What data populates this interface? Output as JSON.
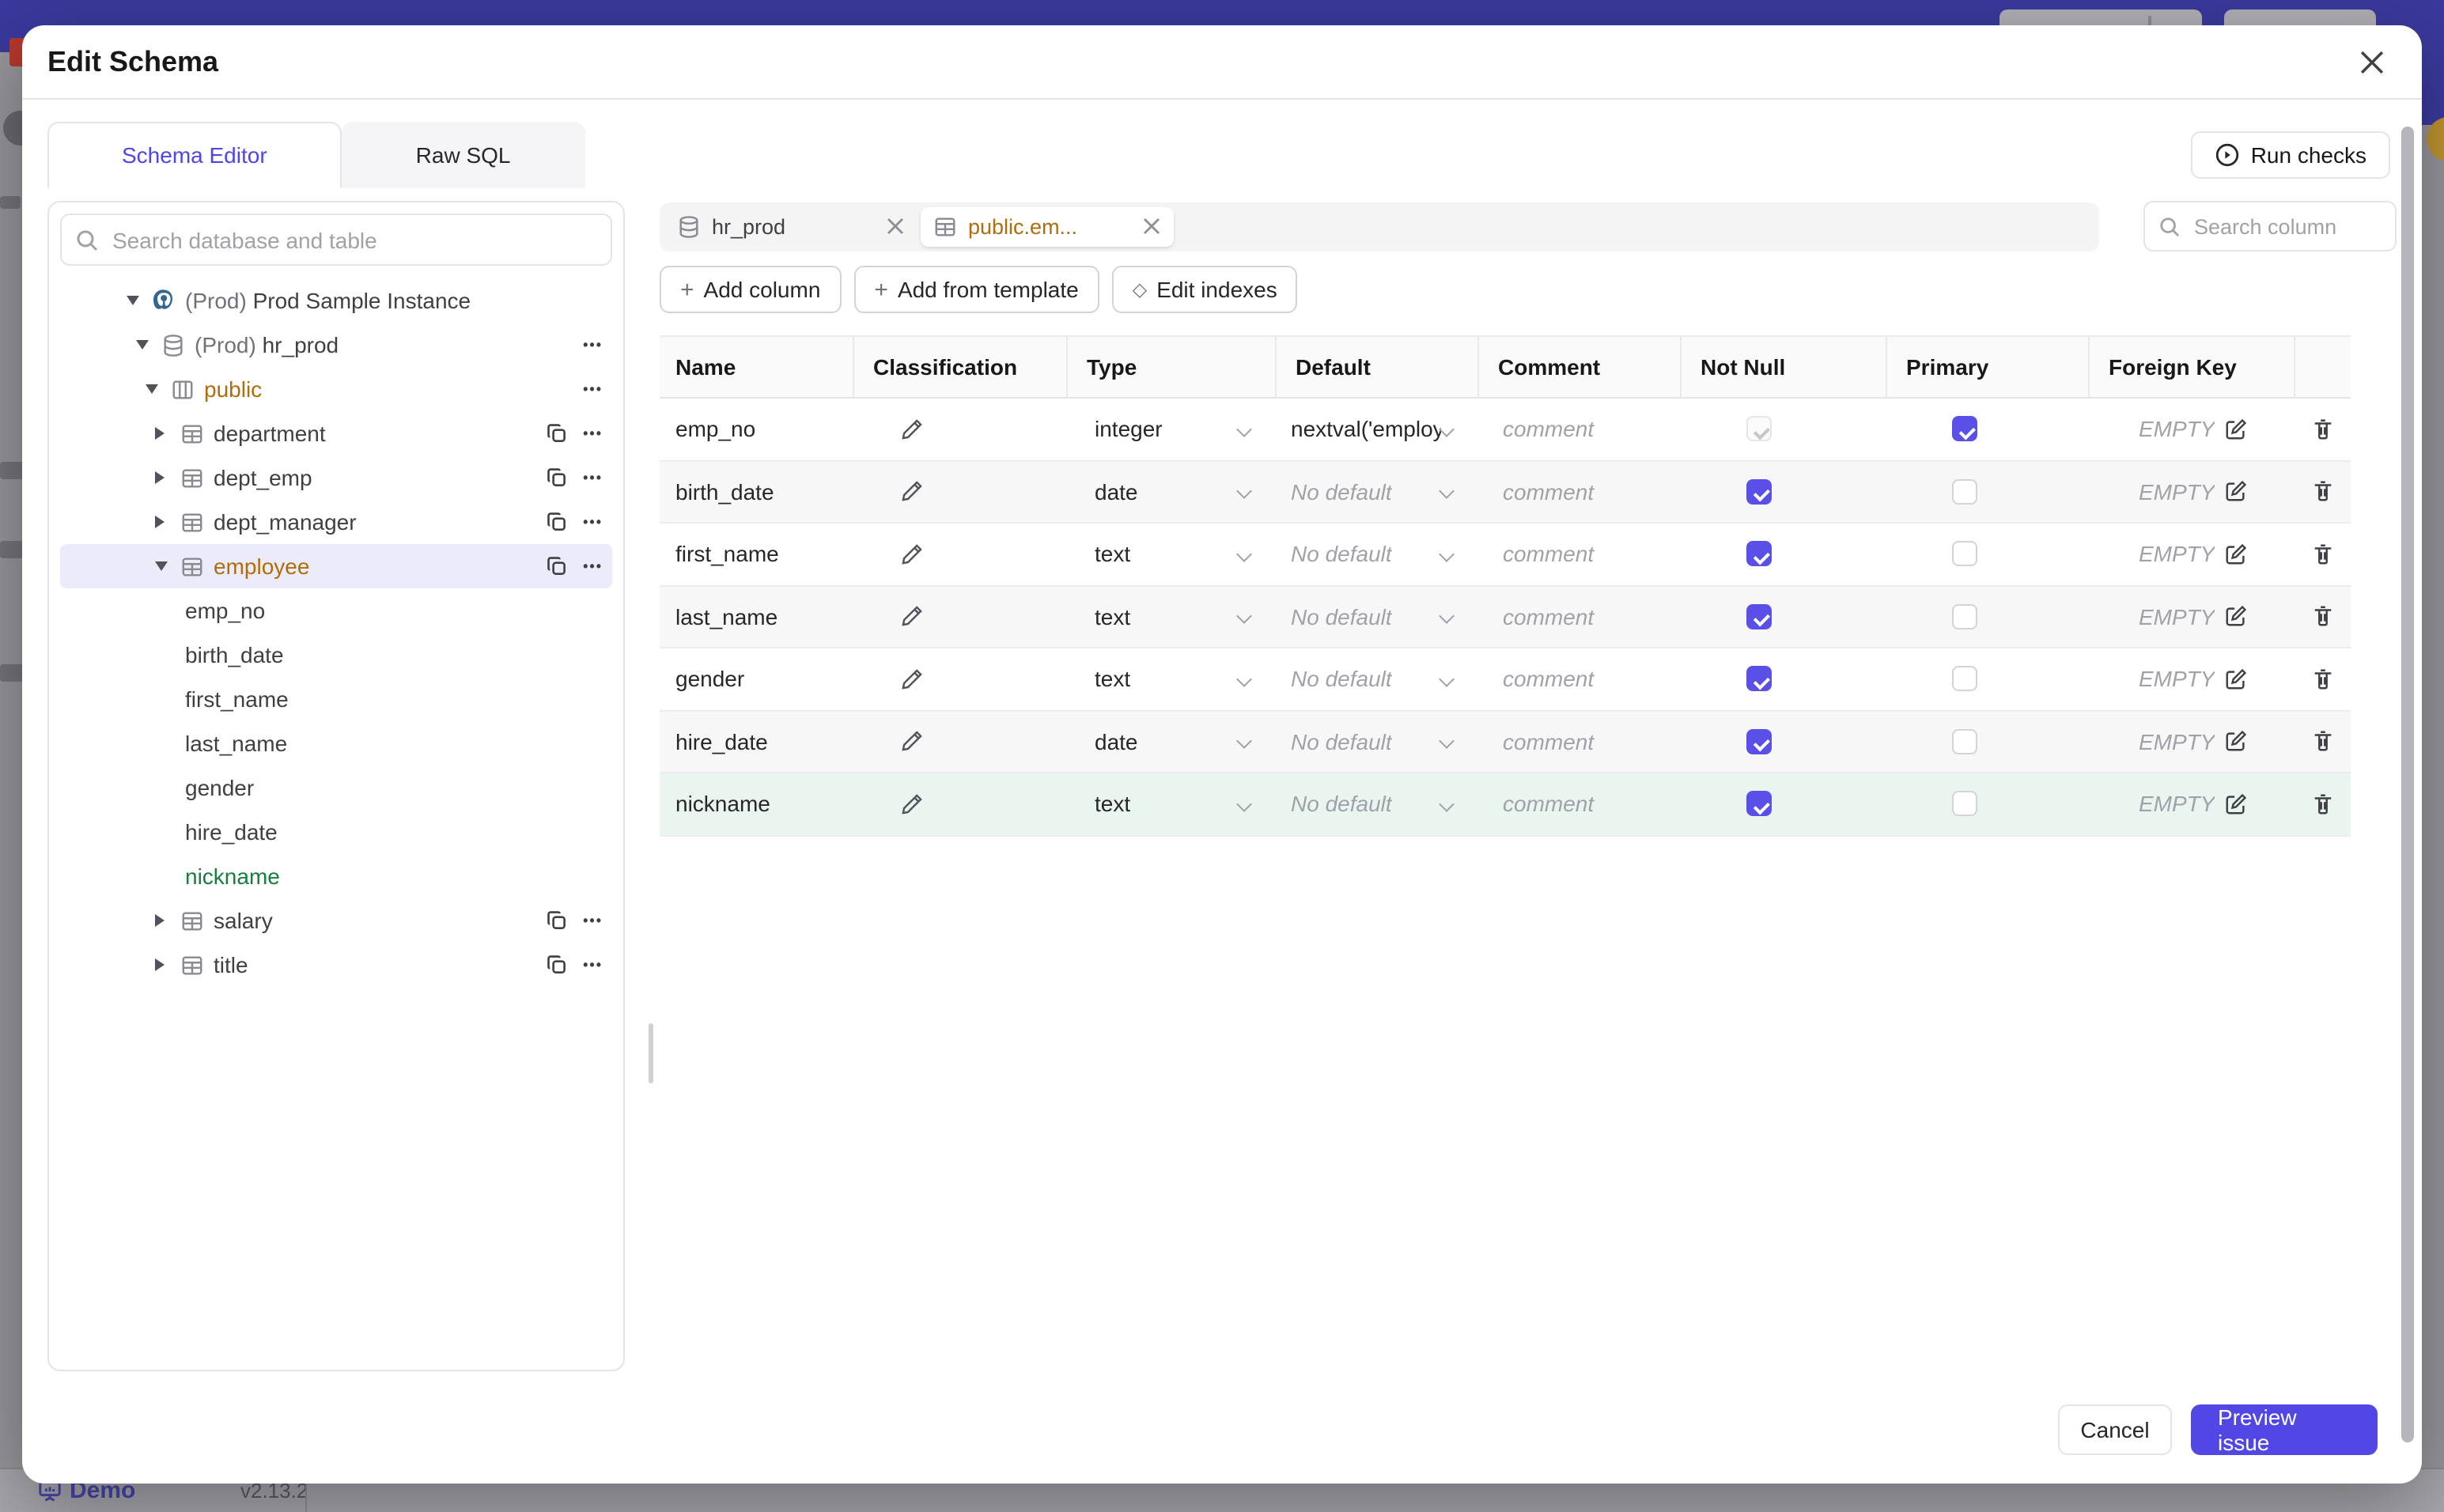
{
  "backdrop": {
    "footer": {
      "brand": "Demo",
      "version": "v2.13.2"
    }
  },
  "modal": {
    "title": "Edit Schema",
    "tabs": [
      {
        "label": "Schema Editor",
        "active": true
      },
      {
        "label": "Raw SQL",
        "active": false
      }
    ],
    "run_checks_label": "Run checks",
    "sidebar": {
      "search_placeholder": "Search database and table",
      "tree": [
        {
          "level": 0,
          "icon": "postgres",
          "caret": "open",
          "prefix": "(Prod) ",
          "label": "Prod Sample Instance",
          "actions": []
        },
        {
          "level": 1,
          "icon": "database",
          "caret": "open",
          "prefix": "(Prod) ",
          "label": "hr_prod",
          "actions": [
            "more"
          ]
        },
        {
          "level": 2,
          "icon": "schema",
          "caret": "open",
          "prefix": "",
          "label": "public",
          "state": "modified",
          "actions": [
            "more"
          ]
        },
        {
          "level": 3,
          "icon": "table",
          "caret": "closed",
          "prefix": "",
          "label": "department",
          "actions": [
            "copy",
            "more"
          ]
        },
        {
          "level": 3,
          "icon": "table",
          "caret": "closed",
          "prefix": "",
          "label": "dept_emp",
          "actions": [
            "copy",
            "more"
          ]
        },
        {
          "level": 3,
          "icon": "table",
          "caret": "closed",
          "prefix": "",
          "label": "dept_manager",
          "actions": [
            "copy",
            "more"
          ]
        },
        {
          "level": 3,
          "icon": "table",
          "caret": "open",
          "prefix": "",
          "label": "employee",
          "state": "modified",
          "selected": true,
          "actions": [
            "copy",
            "more"
          ]
        },
        {
          "level": 4,
          "icon": "none",
          "caret": "none",
          "prefix": "",
          "label": "emp_no",
          "actions": []
        },
        {
          "level": 4,
          "icon": "none",
          "caret": "none",
          "prefix": "",
          "label": "birth_date",
          "actions": []
        },
        {
          "level": 4,
          "icon": "none",
          "caret": "none",
          "prefix": "",
          "label": "first_name",
          "actions": []
        },
        {
          "level": 4,
          "icon": "none",
          "caret": "none",
          "prefix": "",
          "label": "last_name",
          "actions": []
        },
        {
          "level": 4,
          "icon": "none",
          "caret": "none",
          "prefix": "",
          "label": "gender",
          "actions": []
        },
        {
          "level": 4,
          "icon": "none",
          "caret": "none",
          "prefix": "",
          "label": "hire_date",
          "actions": []
        },
        {
          "level": 4,
          "icon": "none",
          "caret": "none",
          "prefix": "",
          "label": "nickname",
          "state": "new",
          "actions": []
        },
        {
          "level": 3,
          "icon": "table",
          "caret": "closed",
          "prefix": "",
          "label": "salary",
          "actions": [
            "copy",
            "more"
          ]
        },
        {
          "level": 3,
          "icon": "table",
          "caret": "closed",
          "prefix": "",
          "label": "title",
          "actions": [
            "copy",
            "more"
          ]
        }
      ]
    },
    "editor": {
      "chips": [
        {
          "icon": "database",
          "label": "hr_prod",
          "active": false
        },
        {
          "icon": "table",
          "label": "public.em...",
          "active": true
        }
      ],
      "column_search_placeholder": "Search column",
      "toolbar": [
        {
          "sym": "plus",
          "label": "Add column"
        },
        {
          "sym": "plus",
          "label": "Add from template"
        },
        {
          "sym": "diamond",
          "label": "Edit indexes"
        }
      ],
      "columns": [
        "Name",
        "Classification",
        "Type",
        "Default",
        "Comment",
        "Not Null",
        "Primary",
        "Foreign Key",
        ""
      ],
      "comment_placeholder": "comment",
      "fk_empty_label": "EMPTY",
      "rows": [
        {
          "name": "emp_no",
          "type": "integer",
          "default": "nextval('employ",
          "default_is_set": true,
          "not_null": true,
          "not_null_disabled": true,
          "primary": true,
          "new": false
        },
        {
          "name": "birth_date",
          "type": "date",
          "default": "No default",
          "default_is_set": false,
          "not_null": true,
          "not_null_disabled": false,
          "primary": false,
          "new": false
        },
        {
          "name": "first_name",
          "type": "text",
          "default": "No default",
          "default_is_set": false,
          "not_null": true,
          "not_null_disabled": false,
          "primary": false,
          "new": false
        },
        {
          "name": "last_name",
          "type": "text",
          "default": "No default",
          "default_is_set": false,
          "not_null": true,
          "not_null_disabled": false,
          "primary": false,
          "new": false
        },
        {
          "name": "gender",
          "type": "text",
          "default": "No default",
          "default_is_set": false,
          "not_null": true,
          "not_null_disabled": false,
          "primary": false,
          "new": false
        },
        {
          "name": "hire_date",
          "type": "date",
          "default": "No default",
          "default_is_set": false,
          "not_null": true,
          "not_null_disabled": false,
          "primary": false,
          "new": false
        },
        {
          "name": "nickname",
          "type": "text",
          "default": "No default",
          "default_is_set": false,
          "not_null": true,
          "not_null_disabled": false,
          "primary": false,
          "new": true
        }
      ]
    },
    "footer": {
      "cancel_label": "Cancel",
      "submit_label": "Preview issue"
    }
  },
  "colors": {
    "accent_indigo": "#4f46e5",
    "checkbox_indigo": "#5a50e8",
    "modified_amber": "#b06d0b",
    "new_green": "#15803d",
    "selected_row_bg": "#ecebfa",
    "new_row_bg": "#e9f5ee",
    "topbar_purple": "#3b3a9e"
  }
}
